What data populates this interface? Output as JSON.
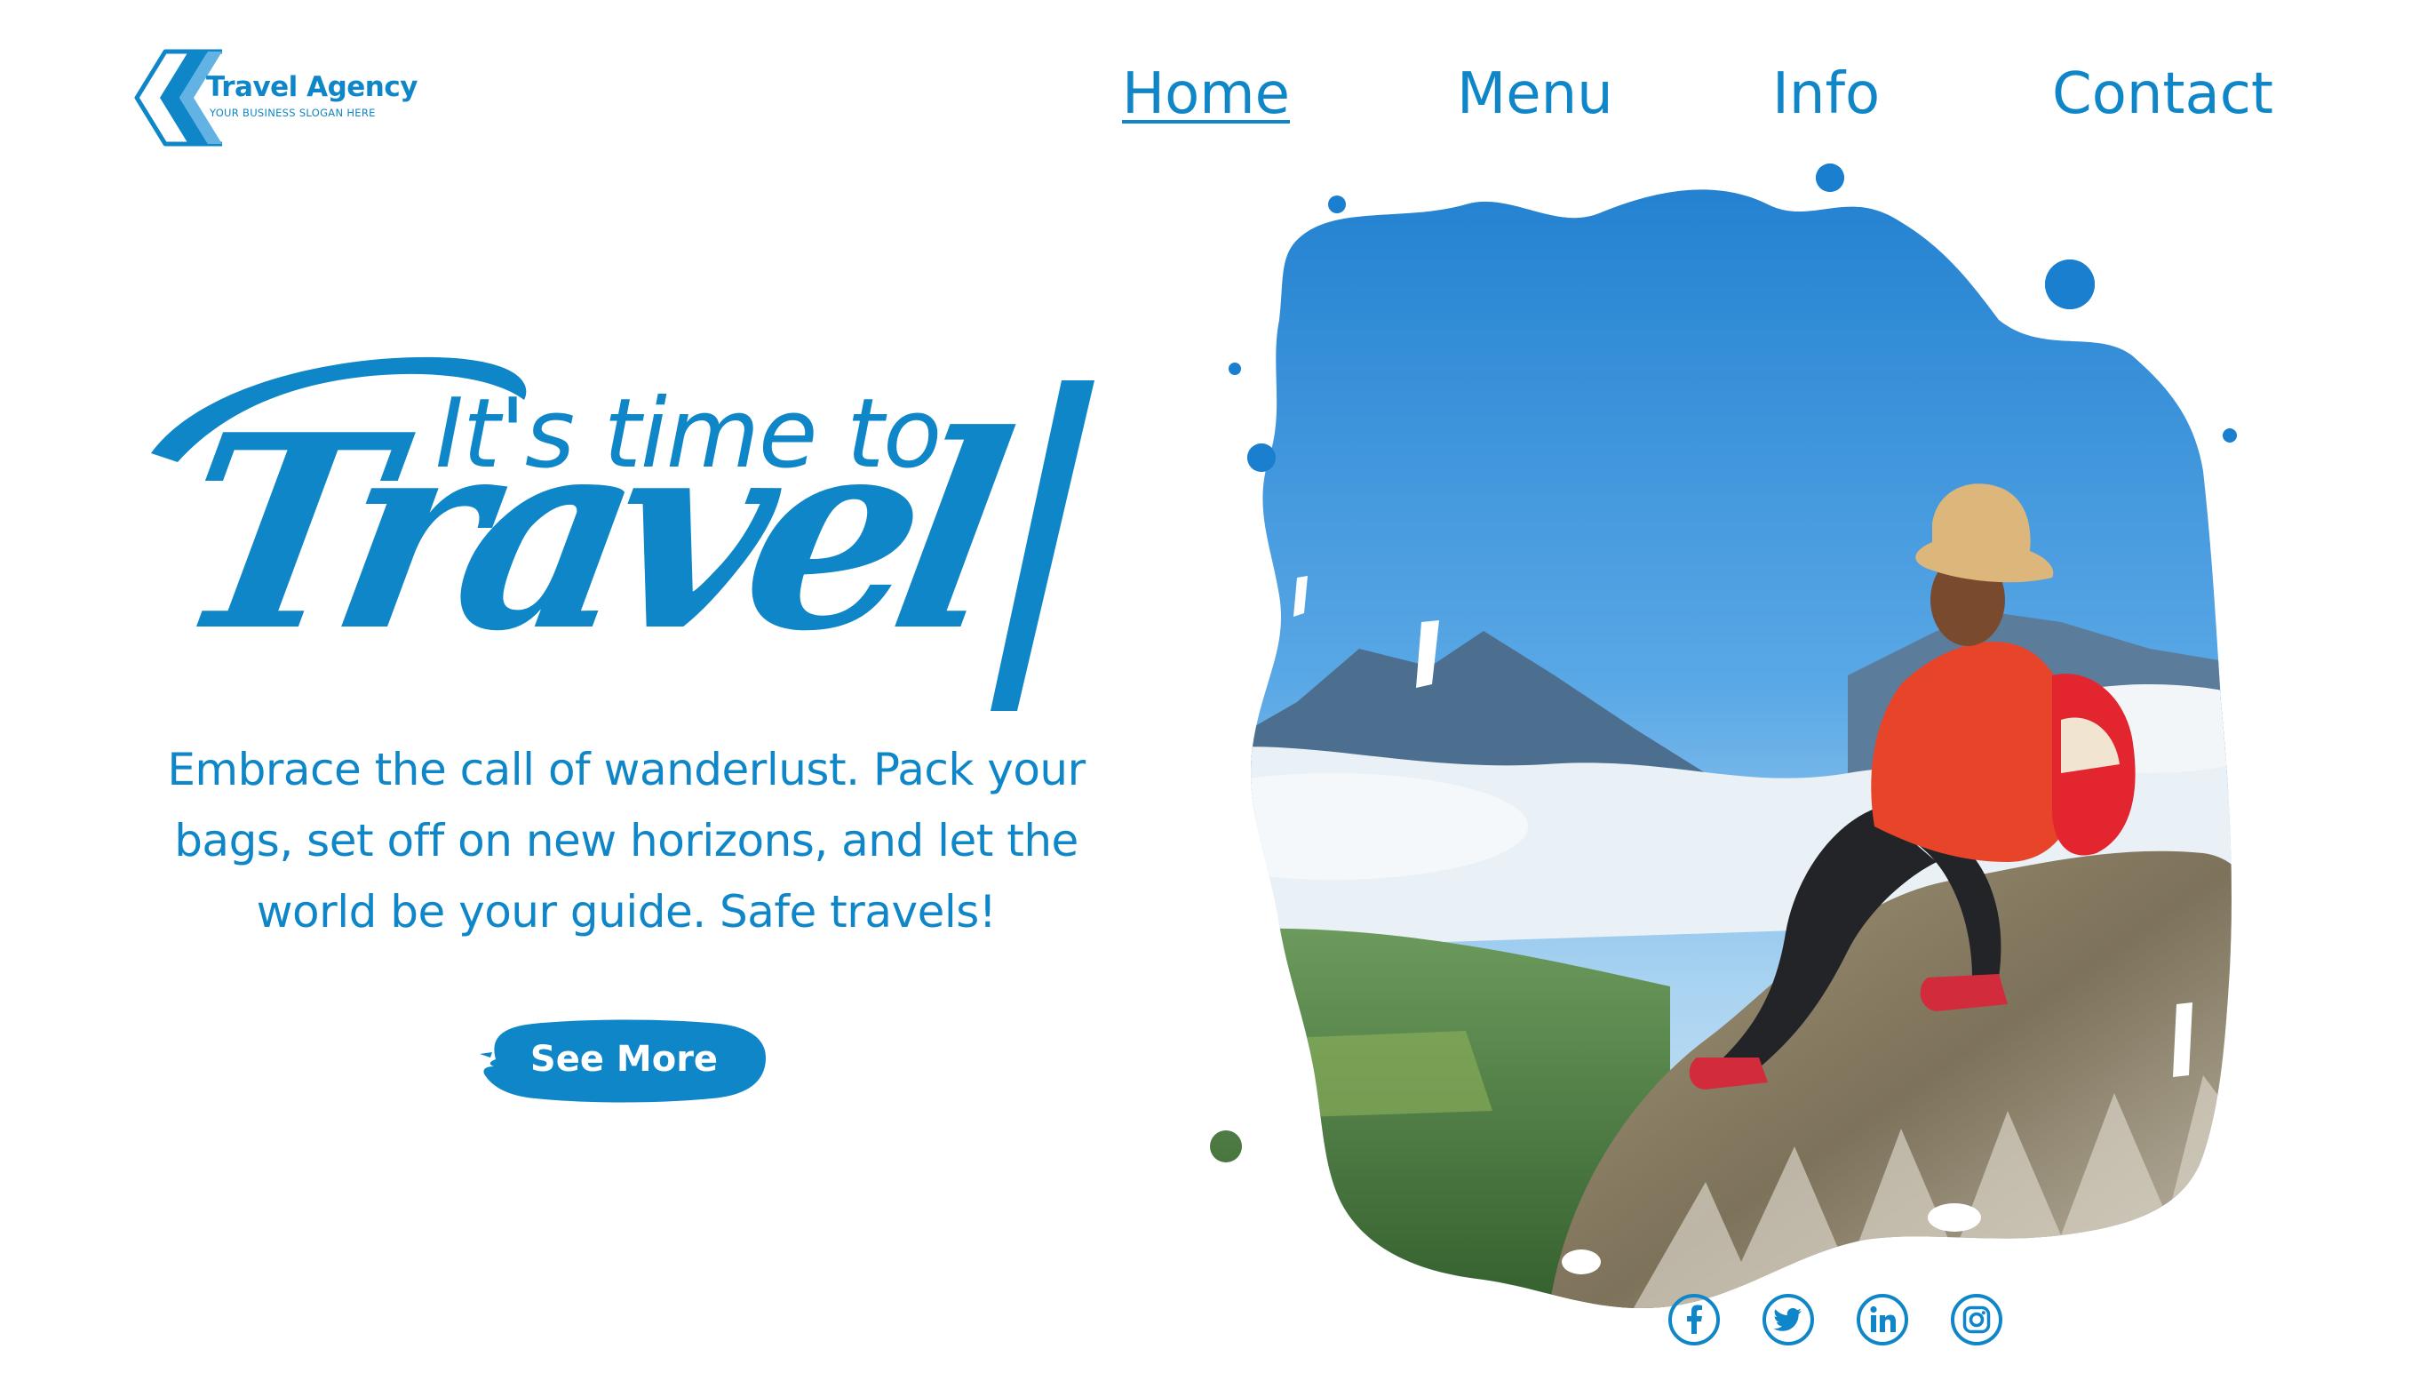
{
  "brand": {
    "name": "Travel Agency",
    "slogan": "YOUR BUSINESS SLOGAN HERE",
    "logo_icon": "chevron-hexagon-logo-icon"
  },
  "nav": {
    "items": [
      {
        "label": "Home",
        "active": true
      },
      {
        "label": "Menu",
        "active": false
      },
      {
        "label": "Info",
        "active": false
      },
      {
        "label": "Contact",
        "active": false
      }
    ]
  },
  "hero": {
    "headline_small": "It's time to",
    "headline_big": "Travel",
    "paragraph_lines": [
      "Embrace the call of wanderlust. Pack your",
      "bags, set off on new horizons, and let the",
      "world be your guide. Safe travels!"
    ],
    "cta_label": "See More"
  },
  "photo": {
    "subject": "hiker-on-mountain-rock-photo"
  },
  "social": [
    {
      "icon": "facebook-icon"
    },
    {
      "icon": "twitter-icon"
    },
    {
      "icon": "linkedin-icon"
    },
    {
      "icon": "instagram-icon"
    }
  ],
  "colors": {
    "brand_blue": "#0e86c8",
    "light_blue": "#62b3e4",
    "background": "#ffffff"
  }
}
